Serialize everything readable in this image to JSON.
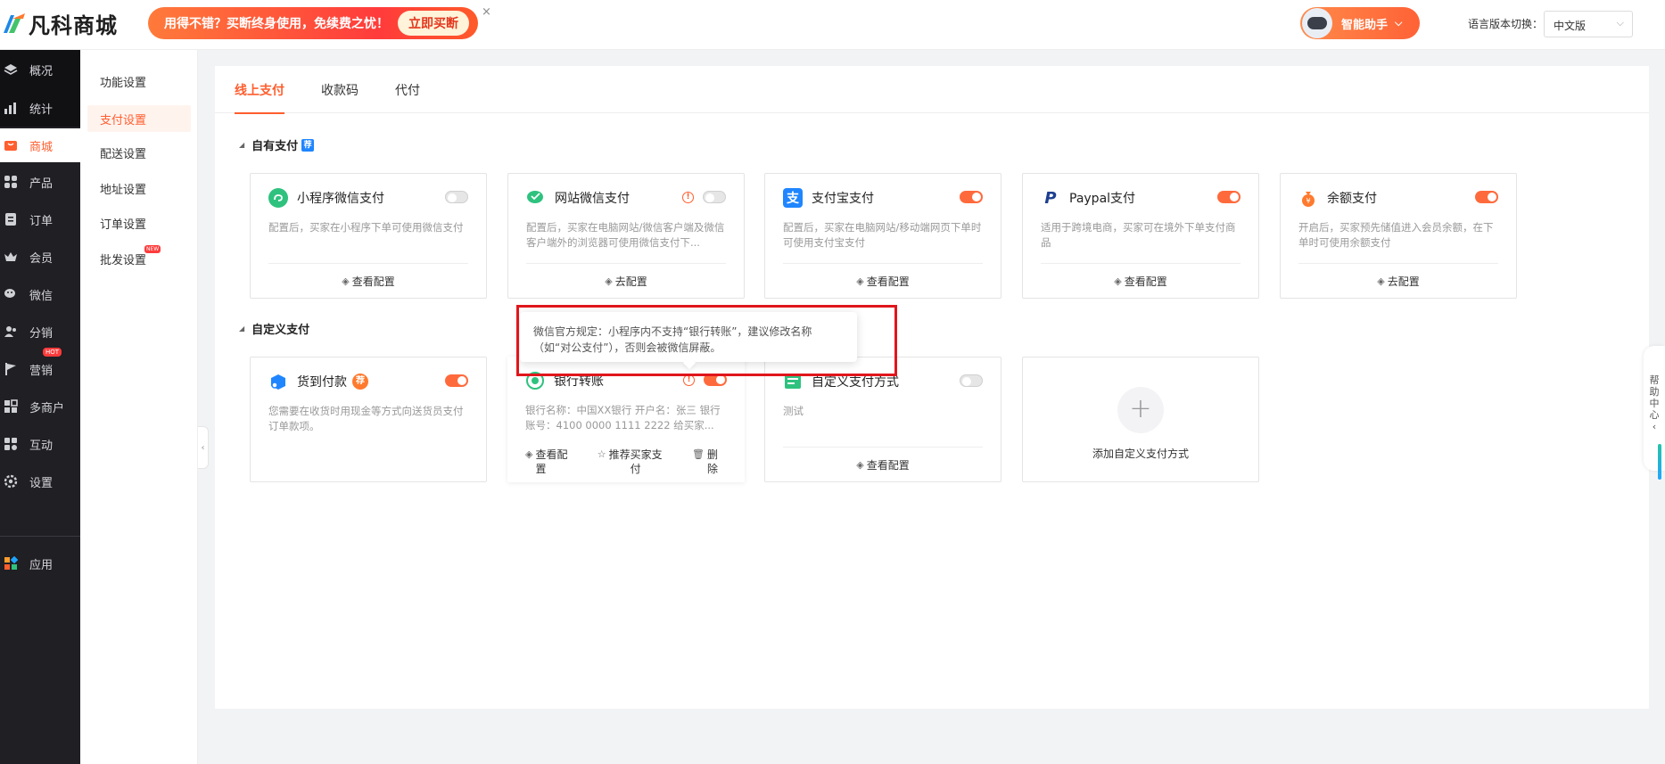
{
  "header": {
    "logo_text": "凡科商城",
    "promo_text": "用得不错？买断终身使用，免续费之忧！",
    "promo_button": "立即买断",
    "promo_close": "×",
    "assistant_label": "智能助手",
    "assistant_chevron": "⌵",
    "language_label": "语言版本切换：",
    "language_value": "中文版"
  },
  "sidebar": {
    "items": [
      {
        "label": "概况",
        "icon": "layers-icon"
      },
      {
        "label": "统计",
        "icon": "bar-chart-icon"
      },
      {
        "label": "商城",
        "icon": "shop-icon"
      },
      {
        "label": "产品",
        "icon": "grid-icon"
      },
      {
        "label": "订单",
        "icon": "order-icon"
      },
      {
        "label": "会员",
        "icon": "crown-icon"
      },
      {
        "label": "微信",
        "icon": "wechat-icon"
      },
      {
        "label": "分销",
        "icon": "users-icon"
      },
      {
        "label": "营销",
        "icon": "flag-icon"
      },
      {
        "label": "多商户",
        "icon": "store-icon"
      },
      {
        "label": "互动",
        "icon": "interact-icon"
      },
      {
        "label": "设置",
        "icon": "gear-icon"
      },
      {
        "label": "应用",
        "icon": "apps-icon"
      }
    ],
    "hot_badge": "HOT",
    "active": "商城"
  },
  "subnav": {
    "items": [
      "功能设置",
      "支付设置",
      "配送设置",
      "地址设置",
      "订单设置",
      "批发设置"
    ],
    "active": "支付设置",
    "new_badge": "NEW"
  },
  "tabs": [
    "线上支付",
    "收款码",
    "代付"
  ],
  "active_tab": "线上支付",
  "sections": {
    "own_title": "自有支付",
    "own_tag": "荐",
    "custom_title": "自定义支付"
  },
  "own_payments": [
    {
      "name": "小程序微信支付",
      "desc": "配置后，买家在小程序下单可使用微信支付",
      "action": "查看配置",
      "enabled": false
    },
    {
      "name": "网站微信支付",
      "desc": "配置后，买家在电脑网站/微信客户端及微信客户端外的浏览器可使用微信支付下...",
      "action": "去配置",
      "enabled": false,
      "warning": true
    },
    {
      "name": "支付宝支付",
      "desc": "配置后，买家在电脑网站/移动端网页下单时可使用支付宝支付",
      "action": "查看配置",
      "enabled": true
    },
    {
      "name": "Paypal支付",
      "desc": "适用于跨境电商，买家可在境外下单支付商品",
      "action": "查看配置",
      "enabled": true
    },
    {
      "name": "余额支付",
      "desc": "开启后，买家预先储值进入会员余额，在下单时可使用余额支付",
      "action": "去配置",
      "enabled": true
    }
  ],
  "custom_payments": [
    {
      "name": "货到付款",
      "tag": "荐",
      "desc": "您需要在收货时用现金等方式向送货员支付订单款项。",
      "enabled": true
    },
    {
      "name": "银行转账",
      "desc": "银行名称：中国XX银行 开户名：张三 银行账号：4100 0000 1111 2222 给买家...",
      "enabled": true,
      "warning": true,
      "actions": {
        "view": "查看配置",
        "view_line2": "置",
        "view_line1": "查看配",
        "recommend_line1": "推荐买家支",
        "recommend_line2": "付",
        "delete_line1": "删",
        "delete_line2": "除"
      }
    },
    {
      "name": "自定义支付方式",
      "desc": "测试",
      "action": "查看配置",
      "enabled": false
    }
  ],
  "add_custom_label": "添加自定义支付方式",
  "add_plus": "+",
  "tooltip_text": "微信官方规定：小程序内不支持“银行转账”，建议修改名称（如“对公支付”），否则会被微信屏蔽。",
  "help_tab": {
    "chars": [
      "帮",
      "助",
      "中",
      "心"
    ],
    "arrow": "‹"
  },
  "collapse_arrow": "‹",
  "colors": {
    "accent": "#ff5e2e",
    "sidebar_bg": "#1f1f24",
    "highlight_box": "#e0161c"
  }
}
